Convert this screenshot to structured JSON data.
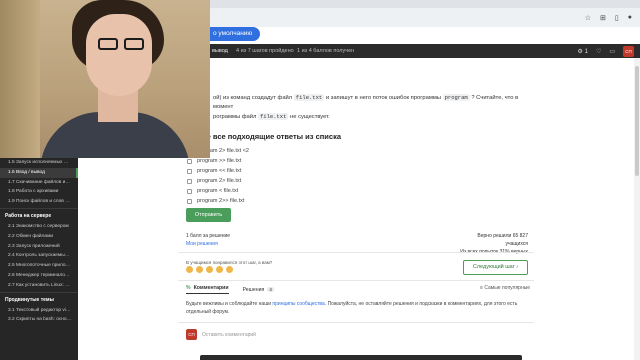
{
  "browser": {
    "default_pill": "о умолчанию",
    "icons": [
      "star-icon",
      "extension-icon",
      "sidebar-icon",
      "profile-icon"
    ]
  },
  "lesson_bar": {
    "title": "вывод",
    "progress": "4 из 7 шагов пройдено",
    "score": "1 из 4 баллов  получен",
    "likes": "1"
  },
  "question": {
    "part1": "ой) из команд создадут файл",
    "code1": "file.txt",
    "part2": "и запишут в него поток ошибок программы",
    "code2": "program",
    "part3": "? Считайте, что в момент",
    "part4": "рограммы файл",
    "code3": "file.txt",
    "part5": "не существует."
  },
  "section_title": "те все подходящие ответы из списка",
  "options": [
    "program 2> file.txt <2",
    "program >> file.txt",
    "program << file.txt",
    "program 2> file.txt",
    "program < file.txt",
    "program 2>> file.txt"
  ],
  "submit_label": "Отправить",
  "stats": {
    "points": "1 балл за решение",
    "my_solutions": "Мои решения",
    "solved_line": "Верно решили 65 827 учащихся",
    "attempts_line": "Из всех попыток 31% верных"
  },
  "feedback_prompt": "В учащимся понравился этот шаг, а вам?",
  "next_step_label": "Следующий шаг",
  "tabs": {
    "comments": "Комментарии",
    "comments_count": "",
    "solutions": "Решения",
    "solutions_count": "4"
  },
  "sort_label": "Самые популярные",
  "rules": {
    "text1": "Будьте вежливы и соблюдайте наши",
    "link": "принципы сообщества",
    "text2": ". Пожалуйста, не оставляйте решения и подсказки в комментариях, для этого есть отдельный форум."
  },
  "comment": {
    "avatar": "СП",
    "placeholder": "Оставить комментарий"
  },
  "sidebar": {
    "items_top": [
      {
        "label": "1.5  Запуск исполняемых …",
        "active": false
      },
      {
        "label": "1.6  Ввод / вывод",
        "active": true
      },
      {
        "label": "1.7  Скачивание файлов и…",
        "active": false
      },
      {
        "label": "1.8  Работа с архивами",
        "active": false
      },
      {
        "label": "1.9  Поиск файлов и слов …",
        "active": false
      }
    ],
    "section2": "Работа на сервере",
    "items_mid": [
      "2.1  Знакомство с сервером",
      "2.2  Обмен файлами",
      "2.3  Запуск приложений",
      "2.4  Контроль запускаемы…",
      "2.5  Многопоточные прило…",
      "2.6  Менеджер терминало…",
      "2.7  Как установить Linux: …"
    ],
    "section3": "Продвинутые темы",
    "items_bottom": [
      "3.1  Текстовый редактор vi…",
      "3.2  Скрипты на bash: осно…"
    ]
  }
}
